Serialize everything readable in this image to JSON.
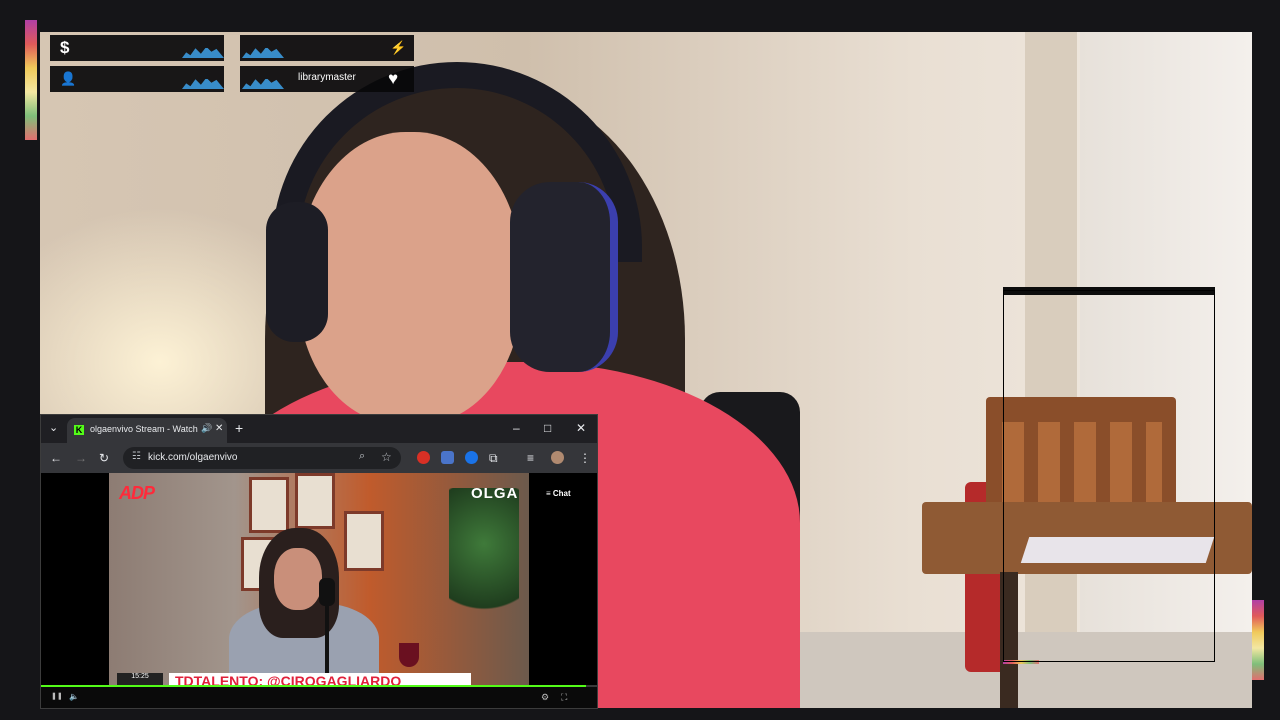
{
  "stream_overlay": {
    "panels": [
      {
        "icon": "dollar-icon",
        "glyph": "$",
        "label": ""
      },
      {
        "icon": "flame-icon",
        "glyph": "⚡",
        "label": ""
      },
      {
        "icon": "user-icon",
        "glyph": "👤",
        "label": ""
      },
      {
        "icon": "heart-icon",
        "glyph": "♥",
        "label": "librarymaster"
      }
    ],
    "accent_colors": {
      "rainbow": [
        "#b13fa6",
        "#e05a5a",
        "#f0c95a",
        "#7fbf7a"
      ],
      "wave": "#3ea1e8"
    }
  },
  "browser": {
    "tab": {
      "favicon_letter": "K",
      "title": "olgaenvivo Stream - Watch",
      "speaker_glyph": "🔊",
      "close_glyph": "✕"
    },
    "new_tab_glyph": "+",
    "tab_search_glyph": "⌄",
    "window_controls": {
      "minimize": "–",
      "maximize": "□",
      "close": "✕"
    },
    "nav": {
      "back": "←",
      "forward": "→",
      "reload": "↻"
    },
    "url": "kick.com/olgaenvivo",
    "menu_glyph": "⋮",
    "accent": "#53fc18"
  },
  "video": {
    "logo_left": "ADP",
    "logo_right": "OLGA",
    "chat_button": "≡ Chat",
    "lower_third": "TDTALENTO: @CIROGAGLIARDO_",
    "clock": "15:25",
    "progress_fraction": 0.98,
    "controls": {
      "pause": "❚❚",
      "volume": "🔈",
      "settings": "⚙",
      "fullscreen": "⛶"
    }
  }
}
